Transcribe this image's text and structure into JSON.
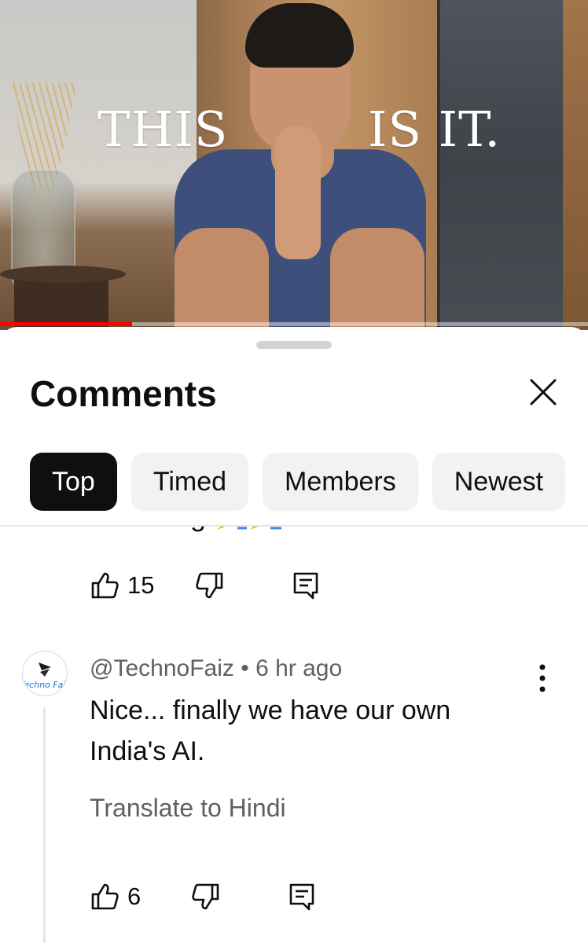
{
  "video": {
    "overlay_left": "THIS",
    "overlay_right": "IS IT.",
    "progress_fraction": 0.225
  },
  "sheet": {
    "title": "Comments",
    "close_icon": "close-icon",
    "filters": [
      {
        "label": "Top",
        "selected": true
      },
      {
        "label": "Timed",
        "selected": false
      },
      {
        "label": "Members",
        "selected": false
      },
      {
        "label": "Newest",
        "selected": false
      }
    ]
  },
  "previous_comment": {
    "cut_text": "Intersting",
    "like_count": "15"
  },
  "comment": {
    "author": "@TechnoFaiz",
    "separator": " • ",
    "time": "6 hr ago",
    "avatar_text": "Techno Fair",
    "text": "Nice... finally we have our own India's AI.",
    "translate": "Translate to Hindi",
    "like_count": "6"
  },
  "colors": {
    "accent": "#ff0000",
    "chip_active_bg": "#0f0f0f",
    "chip_bg": "#f2f2f2",
    "secondary_text": "#606060"
  }
}
